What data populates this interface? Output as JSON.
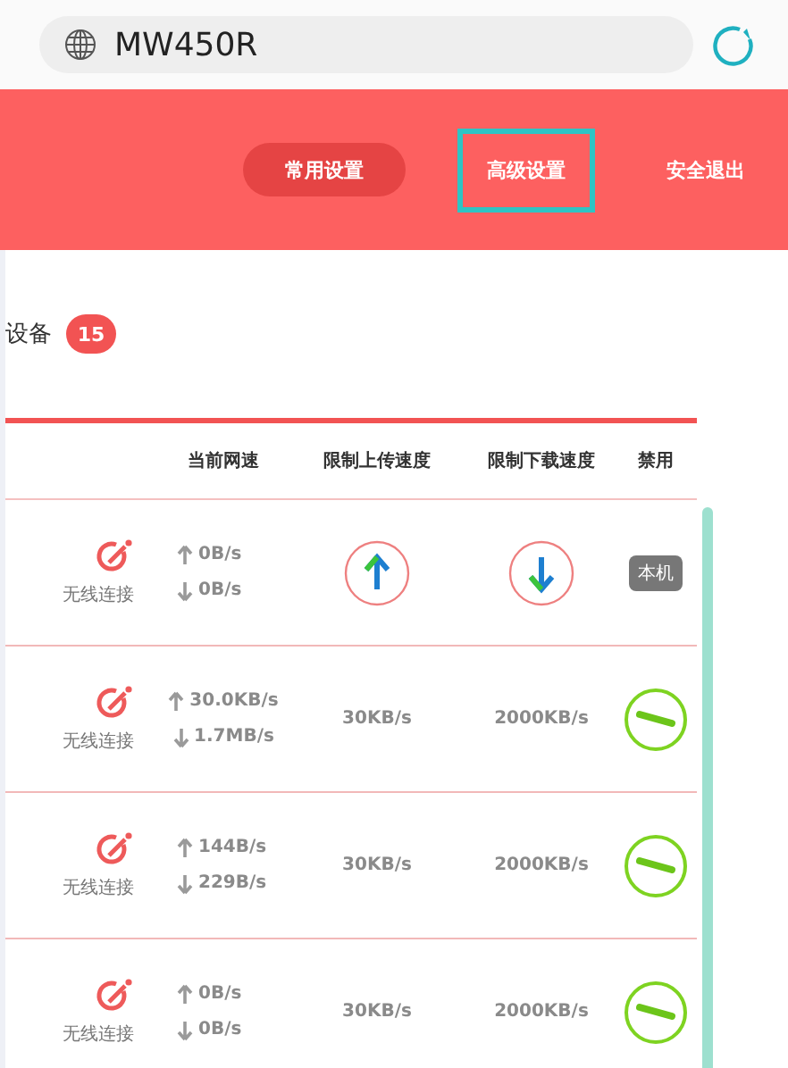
{
  "address_bar": {
    "url": "MW450R"
  },
  "nav": [
    {
      "label": "常用设置",
      "selected": true,
      "focused": false
    },
    {
      "label": "高级设置",
      "selected": false,
      "focused": true
    },
    {
      "label": "安全退出",
      "selected": false,
      "focused": false
    }
  ],
  "section": {
    "title": "设备",
    "count": "15"
  },
  "table": {
    "columns": [
      "当前网速",
      "限制上传速度",
      "限制下载速度",
      "禁用"
    ],
    "rows": [
      {
        "kind": "local",
        "connection": "无线连接",
        "up": "0B/s",
        "down": "0B/s",
        "tag": "本机"
      },
      {
        "kind": "device",
        "connection": "无线连接",
        "up": "30.0KB/s",
        "down": "1.7MB/s",
        "upload_limit": "30KB/s",
        "download_limit": "2000KB/s"
      },
      {
        "kind": "device",
        "connection": "无线连接",
        "up": "144B/s",
        "down": "229B/s",
        "upload_limit": "30KB/s",
        "download_limit": "2000KB/s"
      },
      {
        "kind": "device",
        "connection": "无线连接",
        "up": "0B/s",
        "down": "0B/s",
        "upload_limit": "30KB/s",
        "download_limit": "2000KB/s"
      }
    ]
  }
}
